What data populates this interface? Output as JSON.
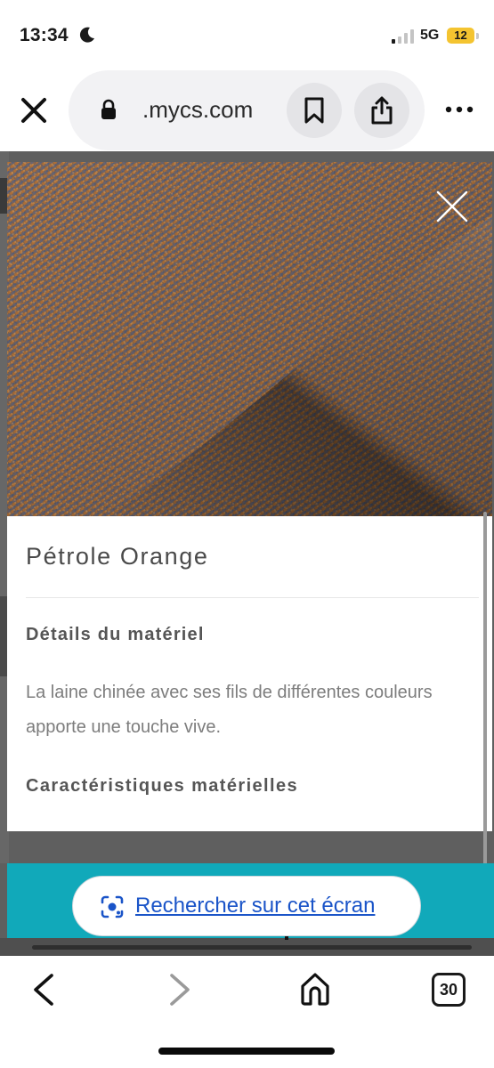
{
  "status_bar": {
    "time": "13:34",
    "network": "5G",
    "battery_level": "12",
    "battery_color": "#f4c430"
  },
  "browser": {
    "url_prefix": "",
    "url_domain": ".mycs.com",
    "icons": [
      "close-icon",
      "lock-icon",
      "bookmark-icon",
      "share-icon",
      "more-icon"
    ]
  },
  "product": {
    "title": "Pétrole Orange",
    "details_heading": "Détails du matériel",
    "description": "La laine chinée avec ses fils de différentes couleurs apporte une touche vive.",
    "features_heading": "Caractéristiques matérielles"
  },
  "lens": {
    "label": "Rechercher sur cet écran",
    "accent": "#11a9ba",
    "link_color": "#1a54c8"
  },
  "nav": {
    "tabs_count": "30",
    "icons": [
      "back-arrow-icon",
      "forward-arrow-icon",
      "home-icon",
      "tabs-icon"
    ]
  }
}
